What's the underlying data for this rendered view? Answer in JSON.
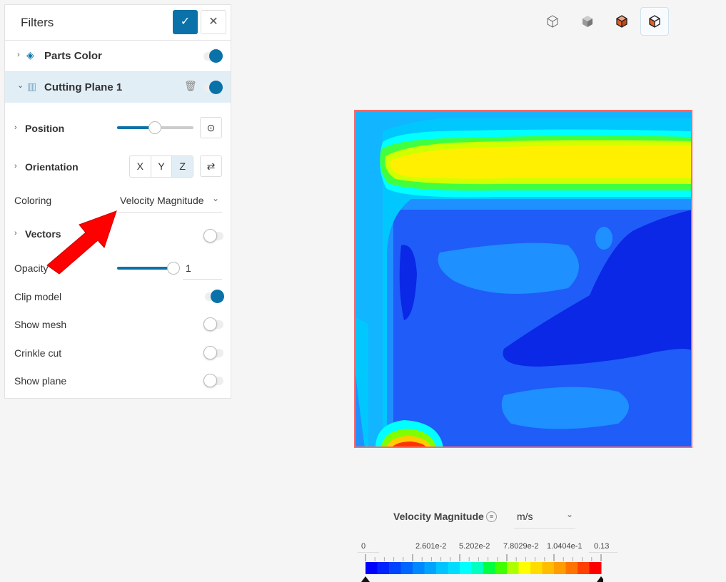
{
  "panel": {
    "title": "Filters",
    "ok_icon": "check-icon",
    "close_icon": "close-icon",
    "parts_color": {
      "label": "Parts Color",
      "enabled": true
    },
    "cutting_plane": {
      "label": "Cutting Plane 1",
      "enabled": true
    },
    "position": {
      "label": "Position",
      "value": 0.5
    },
    "orientation": {
      "label": "Orientation",
      "options": [
        "X",
        "Y",
        "Z"
      ],
      "selected": "Z"
    },
    "coloring": {
      "label": "Coloring",
      "value": "Velocity Magnitude"
    },
    "vectors": {
      "label": "Vectors",
      "enabled": false
    },
    "opacity": {
      "label": "Opacity",
      "value": "1",
      "fraction": 1
    },
    "clip_model": {
      "label": "Clip model",
      "enabled": true
    },
    "show_mesh": {
      "label": "Show mesh",
      "enabled": false
    },
    "crinkle_cut": {
      "label": "Crinkle cut",
      "enabled": false
    },
    "show_plane": {
      "label": "Show plane",
      "enabled": false
    }
  },
  "legend": {
    "title": "Velocity Magnitude",
    "unit": "m/s",
    "ticks": [
      "0",
      "2.601e-2",
      "5.202e-2",
      "7.8029e-2",
      "1.0404e-1",
      "0.13"
    ],
    "colors": [
      "#0000ff",
      "#0022ff",
      "#0044ff",
      "#0066ff",
      "#0088ff",
      "#00a4ff",
      "#00c4ff",
      "#00dcff",
      "#00ffff",
      "#00ffc0",
      "#00ff40",
      "#40ff00",
      "#b0ff00",
      "#ffff00",
      "#ffdc00",
      "#ffbc00",
      "#ff9c00",
      "#ff7400",
      "#ff4000",
      "#ff0000"
    ]
  },
  "accent": "#0a72a8"
}
